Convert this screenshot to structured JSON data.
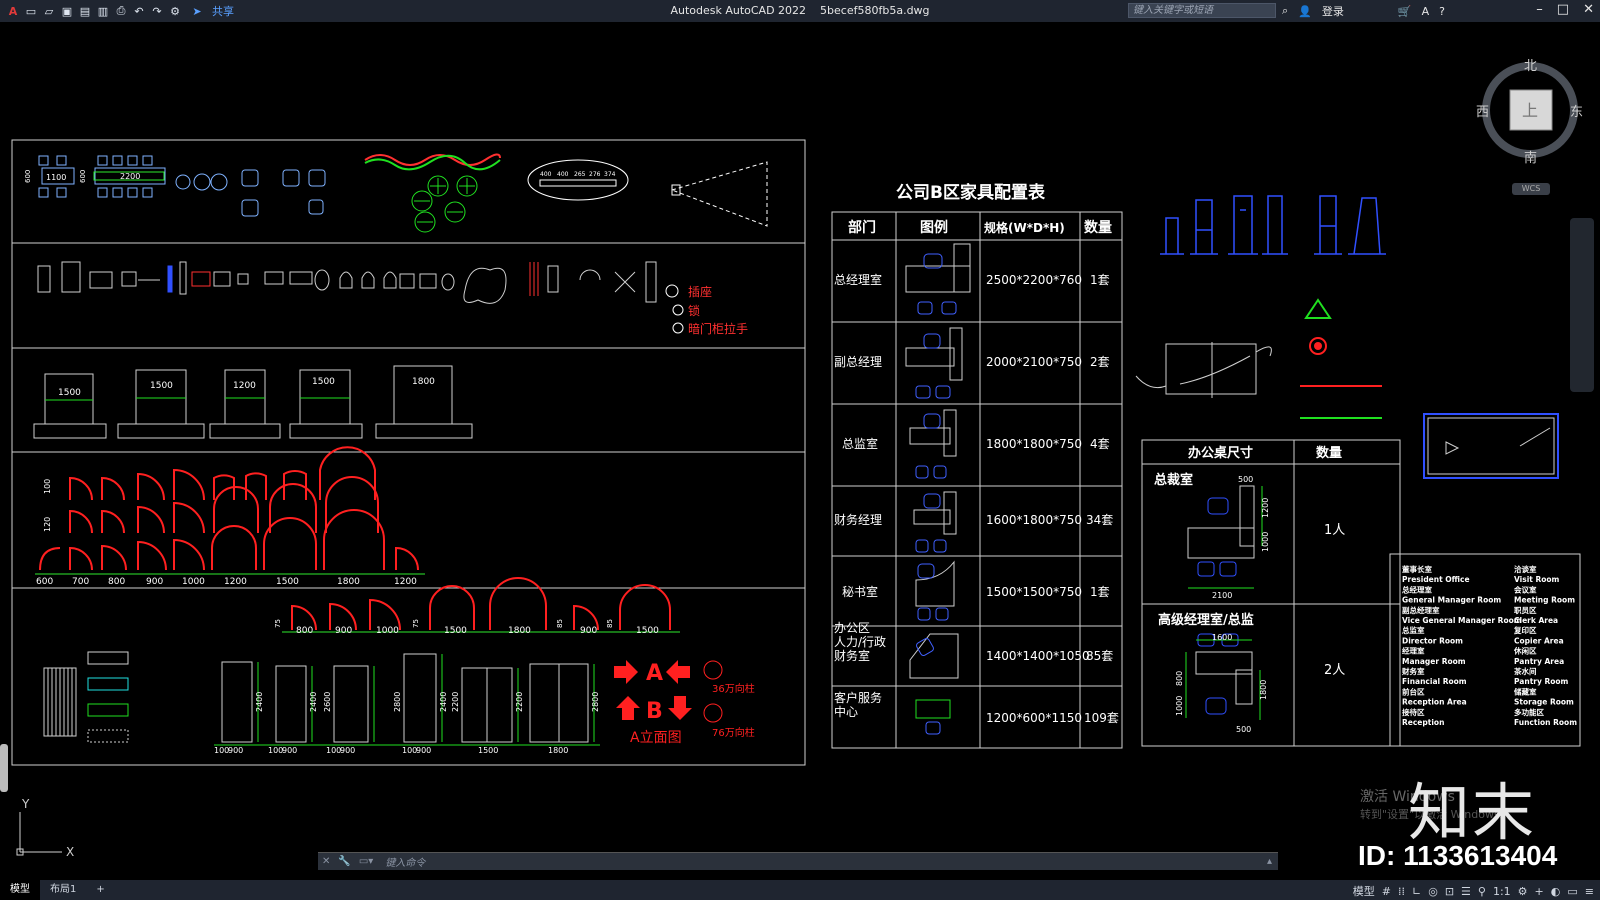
{
  "window": {
    "app_title": "Autodesk AutoCAD 2022",
    "file_name": "5becef580fb5a.dwg",
    "share_label": "共享",
    "search_placeholder": "键入关键字或短语",
    "login_label": "登录",
    "help_icon": "?"
  },
  "viewcube": {
    "north": "北",
    "south": "南",
    "east": "东",
    "west": "西",
    "top": "上",
    "wcs": "WCS"
  },
  "drawing": {
    "legend_labels": {
      "socket": "插座",
      "lock": "锁",
      "handle": "暗门柜拉手"
    },
    "table_dims": [
      "1100",
      "2200",
      "600",
      "600"
    ],
    "ellipse_dims": [
      "400",
      "400",
      "265",
      "276",
      "374"
    ],
    "bed_widths": [
      "1500",
      "1500",
      "1200",
      "1500",
      "1800"
    ],
    "door_row_labels": [
      "100",
      "120"
    ],
    "door_widths_row3": [
      "600",
      "700",
      "800",
      "900",
      "1000",
      "1200",
      "1500",
      "1800",
      "1200"
    ],
    "door_widths_row4": [
      "800",
      "900",
      "1000",
      "1500",
      "1800",
      "900",
      "1500"
    ],
    "small_labels_row4": [
      "75",
      "75",
      "85",
      "85"
    ],
    "door_heights": [
      "2400",
      "2400",
      "2600",
      "2800",
      "2400",
      "2800",
      "2200",
      "2200",
      "2800"
    ],
    "door_bottom_widths": [
      "100",
      "900",
      "100",
      "900",
      "100",
      "900",
      "100",
      "900",
      "1500",
      "1800"
    ],
    "elevation_letters": {
      "a": "A",
      "b": "B"
    },
    "elevation_title": "A立面图",
    "column_labels": {
      "c36": "36万向柱",
      "c76": "76万向柱"
    }
  },
  "furniture_table": {
    "title": "公司B区家具配置表",
    "headers": [
      "部门",
      "图例",
      "规格(W*D*H)",
      "数量"
    ],
    "rows": [
      {
        "dept": "总经理室",
        "spec": "2500*2200*760",
        "qty": "1套"
      },
      {
        "dept": "副总经理",
        "spec": "2000*2100*750",
        "qty": "2套"
      },
      {
        "dept": "总监室",
        "spec": "1800*1800*750",
        "qty": "4套"
      },
      {
        "dept": "财务经理",
        "spec": "1600*1800*750",
        "qty": "34套"
      },
      {
        "dept": "秘书室",
        "spec": "1500*1500*750",
        "qty": "1套"
      },
      {
        "dept": "办公区\n人力/行政\n财务室",
        "spec": "1400*1400*1050",
        "qty": "85套"
      },
      {
        "dept": "客户服务\n中心",
        "spec": "1200*600*1150",
        "qty": "109套"
      }
    ]
  },
  "desk_table": {
    "headers": [
      "办公桌尺寸",
      "数量"
    ],
    "rows": [
      {
        "name": "总裁室",
        "qty": "1人",
        "dims": [
          "500",
          "1200",
          "1000",
          "2100"
        ]
      },
      {
        "name": "高级经理室/总监",
        "qty": "2人",
        "dims": [
          "1600",
          "800",
          "1000",
          "1800",
          "500"
        ]
      }
    ]
  },
  "room_list": {
    "left": [
      "董事长室",
      "President Office",
      "总经理室",
      "General Manager Room",
      "副总经理室",
      "Vice General Manager Room",
      "总监室",
      "Director Room",
      "经理室",
      "Manager Room",
      "财务室",
      "Financial Room",
      "前台区",
      "Reception Area",
      "接待区",
      "Reception"
    ],
    "right": [
      "洽谈室",
      "Visit Room",
      "会议室",
      "Meeting Room",
      "职员区",
      "Clerk Area",
      "复印区",
      "Copier Area",
      "休闲区",
      "Pantry Area",
      "茶水间",
      "Pantry Room",
      "储藏室",
      "Storage Room",
      "多功能区",
      "Function Room"
    ]
  },
  "command_line": {
    "placeholder": "键入命令"
  },
  "status": {
    "tabs": [
      "模型",
      "布局1"
    ],
    "add_tab": "+",
    "model_label": "模型",
    "scale": "1:1"
  },
  "watermark": {
    "logo": "知末",
    "id": "ID: 1133613404",
    "activate": "激活 Windows",
    "activate_sub": "转到\"设置\"以激活 Windows。"
  },
  "ucs": {
    "x": "X",
    "y": "Y"
  }
}
